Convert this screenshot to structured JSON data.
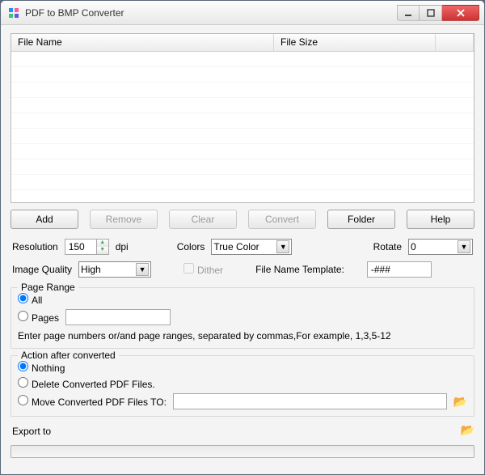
{
  "window": {
    "title": "PDF to BMP Converter"
  },
  "filelist": {
    "columns": {
      "name": "File Name",
      "size": "File Size"
    }
  },
  "buttons": {
    "add": "Add",
    "remove": "Remove",
    "clear": "Clear",
    "convert": "Convert",
    "folder": "Folder",
    "help": "Help"
  },
  "settings": {
    "resolution_label": "Resolution",
    "resolution_value": "150",
    "dpi_label": "dpi",
    "colors_label": "Colors",
    "colors_value": "True Color",
    "rotate_label": "Rotate",
    "rotate_value": "0",
    "image_quality_label": "Image Quality",
    "image_quality_value": "High",
    "dither_label": "Dither",
    "template_label": "File Name Template:",
    "template_value": "-###"
  },
  "page_range": {
    "legend": "Page Range",
    "all": "All",
    "pages": "Pages",
    "pages_value": "",
    "hint": "Enter page numbers or/and page ranges, separated by commas,For example, 1,3,5-12"
  },
  "action": {
    "legend": "Action after converted",
    "nothing": "Nothing",
    "delete": "Delete Converted PDF Files.",
    "move": "Move Converted PDF Files TO:",
    "move_path": ""
  },
  "export": {
    "label": "Export to"
  }
}
